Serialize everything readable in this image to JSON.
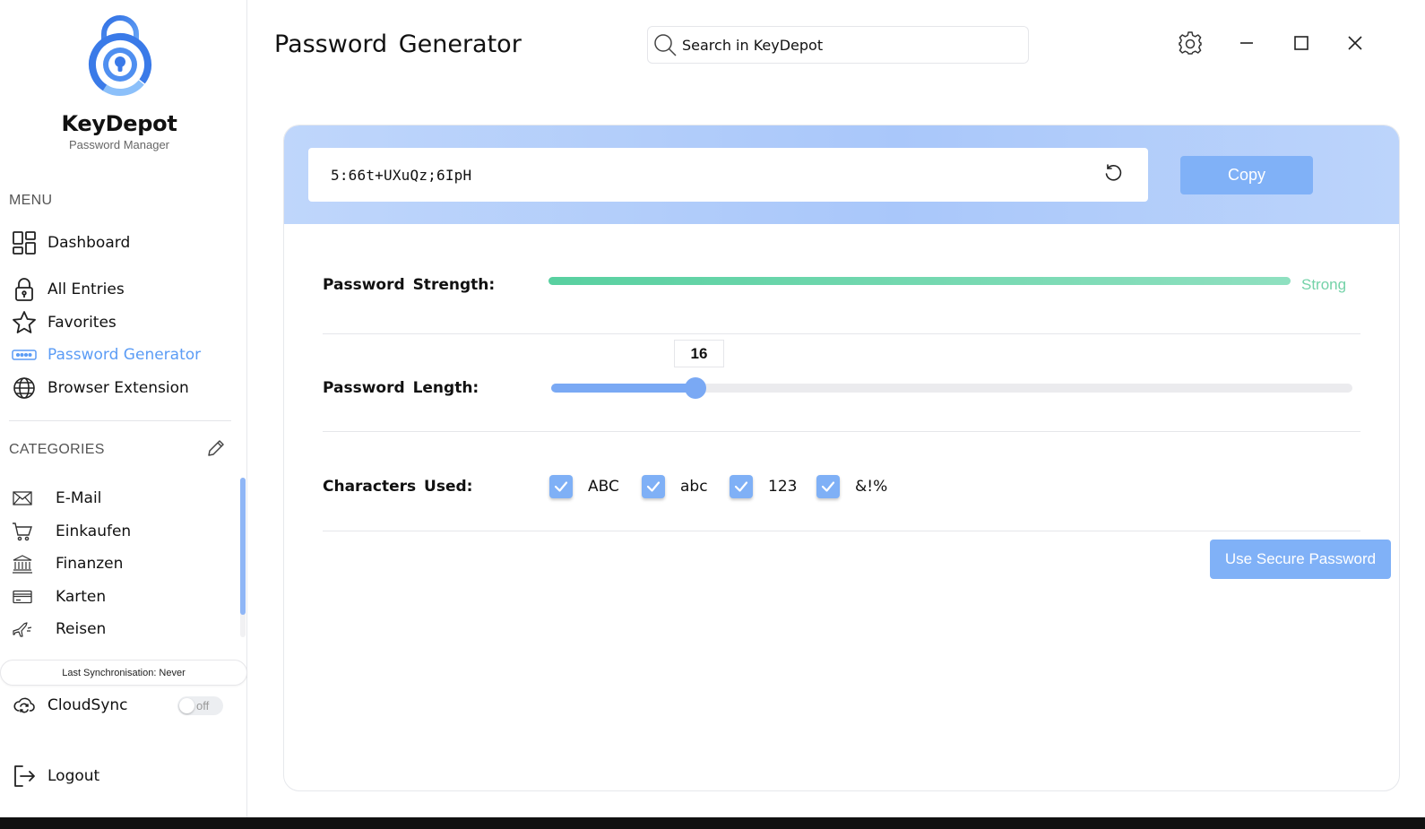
{
  "app": {
    "name": "KeyDepot",
    "subtitle": "Password Manager"
  },
  "sidebar": {
    "menu_label": "MENU",
    "items": [
      {
        "label": "Dashboard",
        "icon": "dashboard-icon"
      },
      {
        "label": "All Entries",
        "icon": "lock-icon"
      },
      {
        "label": "Favorites",
        "icon": "star-icon"
      },
      {
        "label": "Password Generator",
        "icon": "password-dots-icon",
        "active": true
      },
      {
        "label": "Browser Extension",
        "icon": "globe-icon"
      }
    ],
    "categories_label": "CATEGORIES",
    "categories": [
      {
        "label": "E-Mail",
        "icon": "mail-icon"
      },
      {
        "label": "Einkaufen",
        "icon": "cart-icon"
      },
      {
        "label": "Finanzen",
        "icon": "bank-icon"
      },
      {
        "label": "Karten",
        "icon": "card-icon"
      },
      {
        "label": "Reisen",
        "icon": "plane-icon"
      }
    ],
    "sync_status": "Last Synchronisation: Never",
    "cloudsync": {
      "label": "CloudSync",
      "toggle": "off"
    },
    "logout": "Logout"
  },
  "header": {
    "title": "Password Generator",
    "search_placeholder": "Search in KeyDepot"
  },
  "generator": {
    "password": "5:66t+UXuQz;6IpH",
    "copy_label": "Copy",
    "strength": {
      "label": "Password Strength:",
      "value": "Strong",
      "fraction": 1.0
    },
    "length": {
      "label": "Password Length:",
      "value": 16,
      "display": "16",
      "fraction": 0.18
    },
    "characters": {
      "label": "Characters Used:",
      "options": [
        {
          "label": "ABC",
          "checked": true
        },
        {
          "label": "abc",
          "checked": true
        },
        {
          "label": "123",
          "checked": true
        },
        {
          "label": "&!%",
          "checked": true
        }
      ]
    },
    "use_label": "Use Secure Password"
  },
  "colors": {
    "accent": "#80b1f7",
    "strength": "#58d0a0",
    "active_nav": "#5b9cf5"
  }
}
